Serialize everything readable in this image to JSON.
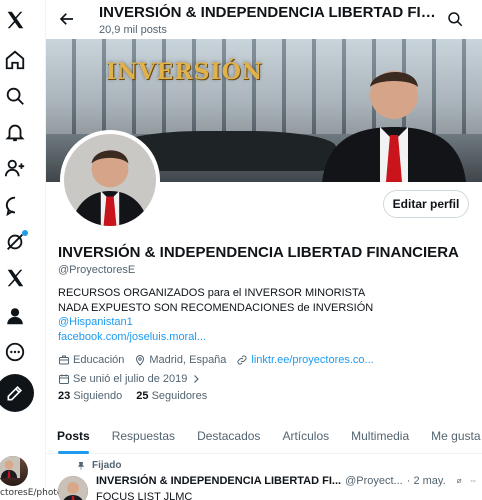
{
  "nav": {
    "items": [
      "x-logo-icon",
      "home-icon",
      "search-icon",
      "bell-icon",
      "person-add-icon",
      "chat-icon",
      "grok-icon",
      "x-premium-icon",
      "profile-icon",
      "more-icon"
    ],
    "me_handle_tooltip": "ctoresE/photo"
  },
  "header": {
    "title": "INVERSIÓN & INDEPENDENCIA LIBERTAD FINANCIERA",
    "posts_count": "20,9 mil posts"
  },
  "banner": {
    "word": "INVERSIÓN"
  },
  "profile": {
    "edit_label": "Editar perfil",
    "name": "INVERSIÓN & INDEPENDENCIA LIBERTAD FINANCIERA",
    "handle": "@ProyectoresE",
    "bio_line1": "RECURSOS ORGANIZADOS para el INVERSOR MINORISTA",
    "bio_line2": "NADA EXPUESTO SON RECOMENDACIONES de INVERSIÓN",
    "bio_mention": "@Hispanistan1",
    "bio_link": "facebook.com/joseluis.moral...",
    "category": "Educación",
    "location": "Madrid, España",
    "website": "linktr.ee/proyectores.co...",
    "joined": "Se unió el julio de 2019",
    "following_count": "23",
    "following_label": "Siguiendo",
    "followers_count": "25",
    "followers_label": "Seguidores"
  },
  "tabs": [
    "Posts",
    "Respuestas",
    "Destacados",
    "Artículos",
    "Multimedia",
    "Me gusta"
  ],
  "pinned_post": {
    "pinned_label": "Fijado",
    "author": "INVERSIÓN & INDEPENDENCIA LIBERTAD FI...",
    "handle": "@Proyect...",
    "date": "· 2 may.",
    "text": "FOCUS LIST JLMC"
  },
  "colors": {
    "accent": "#1d9bf0",
    "text": "#0f1419",
    "muted": "#536471"
  }
}
